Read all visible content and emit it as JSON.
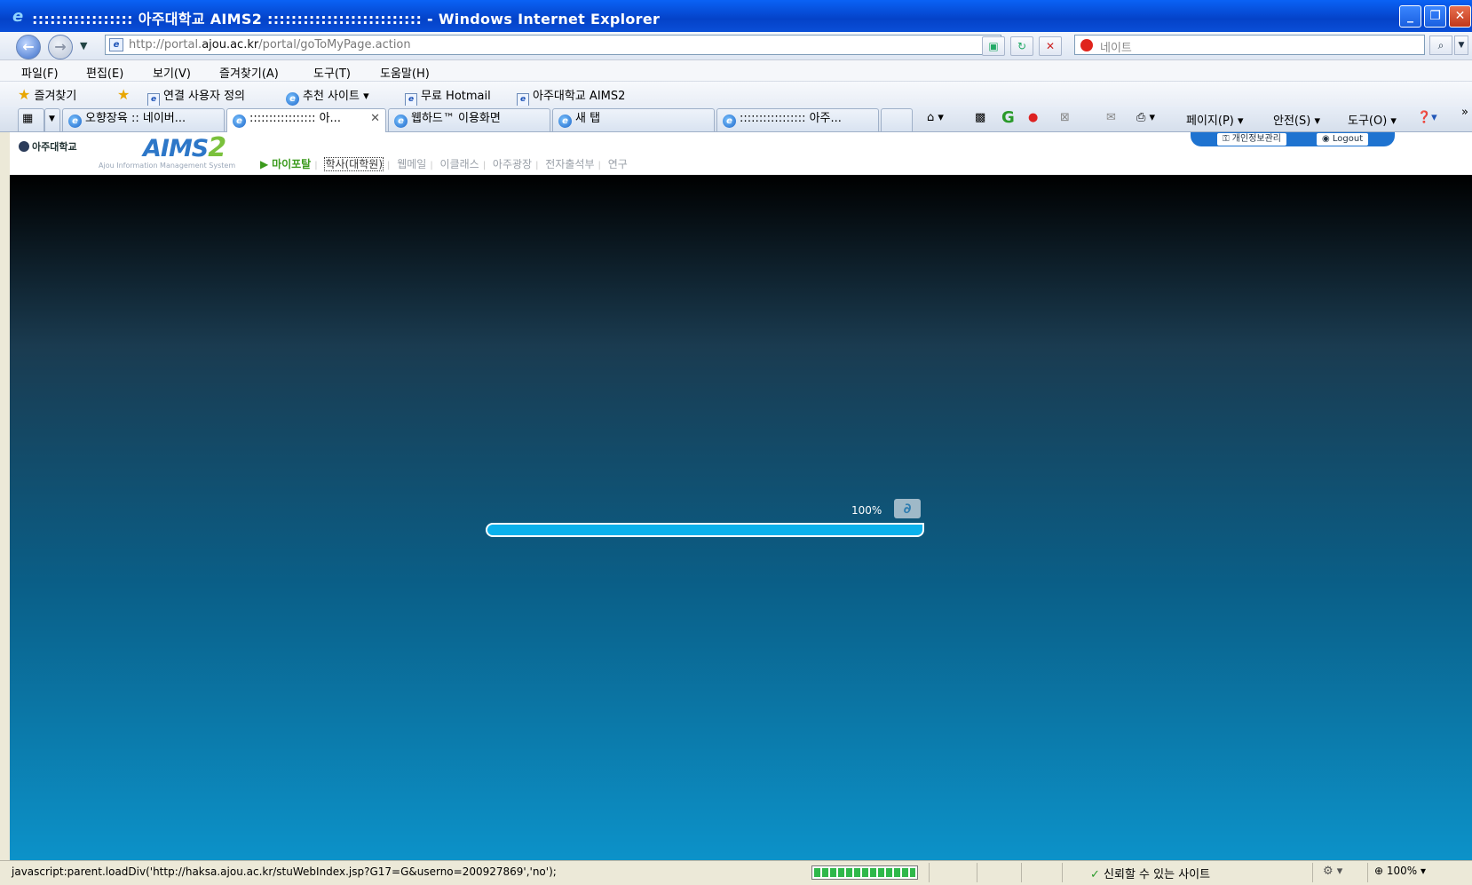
{
  "window": {
    "title": "::::::::::::::::: 아주대학교 AIMS2 :::::::::::::::::::::::::: - Windows Internet Explorer",
    "minimize": "_",
    "maximize": "❐",
    "close": "✕"
  },
  "address": {
    "url_prefix": "http://portal.",
    "url_domain": "ajou.ac.kr",
    "url_path": "/portal/goToMyPage.action",
    "search_placeholder": "네이트"
  },
  "menu": [
    "파일(F)",
    "편집(E)",
    "보기(V)",
    "즐겨찾기(A)",
    "도구(T)",
    "도움말(H)"
  ],
  "favorites": {
    "label": "즐겨찾기",
    "items": [
      "연결 사용자 정의",
      "추천 사이트 ▾",
      "무료 Hotmail",
      "아주대학교 AIMS2"
    ]
  },
  "tabs": [
    {
      "label": "오향장육 :: 네이버..."
    },
    {
      "label": "::::::::::::::::: 아..."
    },
    {
      "label": "웹하드™ 이용화면"
    },
    {
      "label": "새 탭"
    },
    {
      "label": "::::::::::::::::: 아주..."
    }
  ],
  "tab_close": "✕",
  "commands": {
    "page": "페이지(P) ▾",
    "safety": "안전(S) ▾",
    "tools": "도구(O) ▾",
    "more": "»"
  },
  "portal": {
    "school": "아주대학교",
    "logo_text": "AIMS",
    "logo_num": "2",
    "logo_sub": "Ajou Information Management System",
    "nav": [
      "마이포탈",
      "학사(대학원)",
      "웹메일",
      "이클래스",
      "아주광장",
      "전자출석부",
      "연구"
    ],
    "privacy_button": "개인정보관리",
    "logout_button": "Logout"
  },
  "loader": {
    "percent_text": "100%",
    "progress": 1.0
  },
  "status": {
    "text": "javascript:parent.loadDiv('http://haksa.ajou.ac.kr/stuWebIndex.jsp?G17=G&userno=200927869','no');",
    "zone": "신뢰할 수 있는 사이트",
    "zoom": "100%"
  }
}
